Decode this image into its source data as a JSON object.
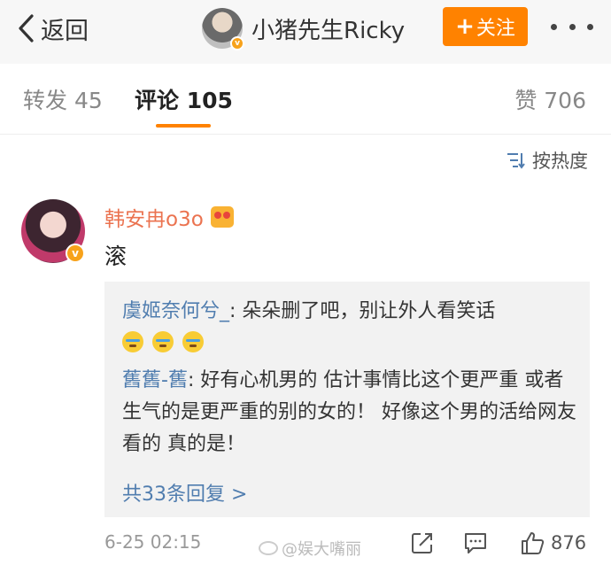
{
  "header": {
    "back_label": "返回",
    "author_name": "小猪先生Ricky",
    "verified_mark": "v",
    "follow_label": "关注",
    "follow_plus": "+"
  },
  "tabs": {
    "repost": "转发 45",
    "comments": "评论 105",
    "likes": "赞 706"
  },
  "sort_label": "按热度",
  "comment": {
    "author": "韩安冉o3o",
    "verified_mark": "v",
    "text": "滚",
    "replies": [
      {
        "name": "虞姬奈何兮_",
        "separator": ": ",
        "text": "朵朵删了吧，别让外人看笑话"
      },
      {
        "name": "舊舊-舊",
        "separator": ": ",
        "text": "好有心机男的 估计事情比这个更严重 或者生气的是更严重的别的女的！ 好像这个男的活给网友看的 真的是！"
      }
    ],
    "more_replies": "共33条回复 >",
    "time": "6-25 02:15",
    "like_count": "876"
  },
  "watermark": "@娱大嘴丽",
  "colors": {
    "accent": "#ff8200",
    "link": "#507daf",
    "username": "#eb7350"
  }
}
